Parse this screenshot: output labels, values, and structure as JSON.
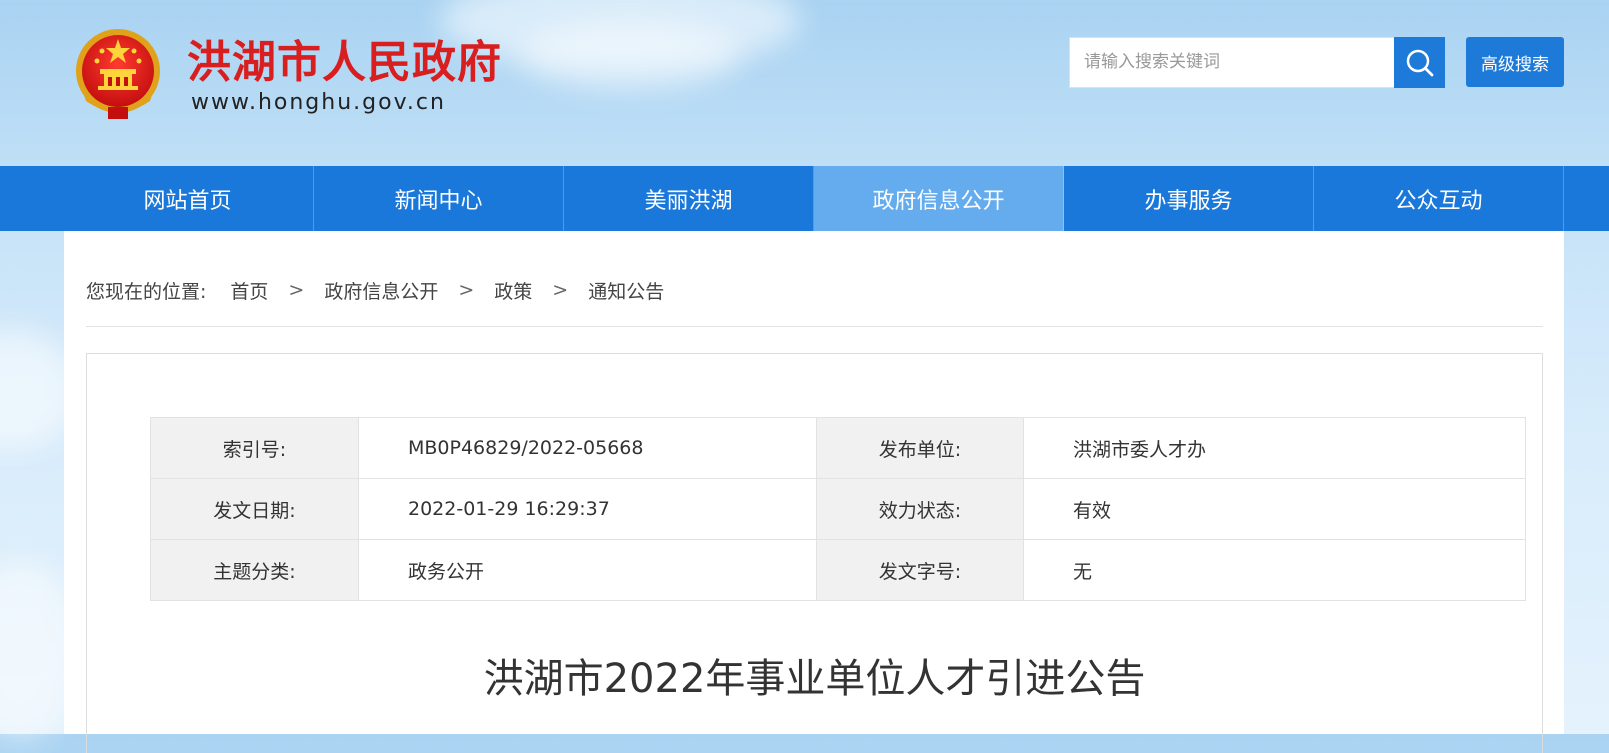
{
  "header": {
    "site_name": "洪湖市人民政府",
    "site_url": "www.honghu.gov.cn",
    "search_placeholder": "请输入搜索关键词",
    "advanced_search_label": "高级搜索",
    "search_icon": "search-icon",
    "emblem_icon": "national-emblem-icon"
  },
  "nav": {
    "items": [
      {
        "label": "网站首页"
      },
      {
        "label": "新闻中心"
      },
      {
        "label": "美丽洪湖"
      },
      {
        "label": "政府信息公开",
        "active": true
      },
      {
        "label": "办事服务"
      },
      {
        "label": "公众互动"
      }
    ]
  },
  "breadcrumb": {
    "prefix": "您现在的位置:",
    "items": [
      "首页",
      "政府信息公开",
      "政策",
      "通知公告"
    ],
    "separator": ">"
  },
  "meta": {
    "rows": [
      {
        "k1": "索引号:",
        "v1": "MB0P46829/2022-05668",
        "k2": "发布单位:",
        "v2": "洪湖市委人才办"
      },
      {
        "k1": "发文日期:",
        "v1": "2022-01-29 16:29:37",
        "k2": "效力状态:",
        "v2": "有效"
      },
      {
        "k1": "主题分类:",
        "v1": "政务公开",
        "k2": "发文字号:",
        "v2": "无"
      }
    ]
  },
  "article": {
    "title": "洪湖市2022年事业单位人才引进公告"
  },
  "colors": {
    "brand_red": "#d81e1e",
    "nav_blue": "#1a78db",
    "nav_active": "#64acee",
    "button_blue": "#1e7ad9"
  }
}
